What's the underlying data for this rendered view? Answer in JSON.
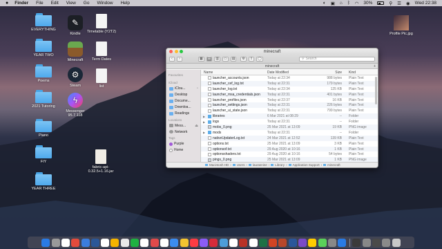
{
  "menubar": {
    "apple": "",
    "items": [
      "Finder",
      "File",
      "Edit",
      "View",
      "Go",
      "Window",
      "Help"
    ],
    "battery": "30%",
    "clock": "Wed 22:38"
  },
  "desktop_left": [
    {
      "label": "EVERYTHING",
      "type": "folder"
    },
    {
      "label": "YEAR TWO",
      "type": "folder"
    },
    {
      "label": "Poems",
      "type": "folder"
    },
    {
      "label": "2021 Tutoring",
      "type": "folder"
    },
    {
      "label": "Piano",
      "type": "folder"
    },
    {
      "label": "FIY",
      "type": "folder"
    },
    {
      "label": "YEAR THREE",
      "type": "folder"
    }
  ],
  "desktop_apps": [
    {
      "label": "Kindle",
      "icon": "kindle-icon",
      "color": "#1c1f25"
    },
    {
      "label": "Minecraft",
      "icon": "minecraft-icon",
      "color": "#5a8f3a"
    },
    {
      "label": "Steam",
      "icon": "steam-icon",
      "color": "#1b2838"
    },
    {
      "label": "Messenger\n95.7.118",
      "icon": "messenger-icon",
      "color": "#8b5cf6"
    }
  ],
  "desktop_docs": [
    {
      "label": "Timetable (Y2T2)"
    },
    {
      "label": "Term Dates"
    },
    {
      "label": "list"
    }
  ],
  "desktop_jar": {
    "label": "fabric-api-0.32.5+1.16.jar"
  },
  "desktop_right": {
    "label": "Profile Pic.jpg"
  },
  "finder": {
    "title": "minecraft",
    "path_title": "minecraft",
    "search_placeholder": "Search",
    "columns": {
      "name": "Name",
      "date": "Date Modified",
      "size": "Size",
      "kind": "Kind"
    },
    "sidebar": {
      "favourites_header": "Favourites",
      "icloud_header": "iCloud",
      "locations_header": "Locations",
      "tags_header": "Tags",
      "icloud_items": [
        "iClou...",
        "Desktop",
        "Docume...",
        "Downloa...",
        "Readings"
      ],
      "location_items": [
        "Mess...",
        "Network"
      ],
      "tag_items": [
        {
          "label": "Purple",
          "color": "#a259d9"
        },
        {
          "label": "Home",
          "color": "#cfcfcf"
        }
      ]
    },
    "rows": [
      {
        "name": "launcher_accounts.json",
        "date": "Today at 22:34",
        "size": "988 bytes",
        "kind": "Plain Text",
        "type": "file",
        "disclosure": ""
      },
      {
        "name": "launcher_cef_log.txt",
        "date": "Today at 22:31",
        "size": "179 bytes",
        "kind": "Plain Text",
        "type": "file",
        "disclosure": ""
      },
      {
        "name": "launcher_log.txt",
        "date": "Today at 22:34",
        "size": "125 KB",
        "kind": "Plain Text",
        "type": "file",
        "disclosure": ""
      },
      {
        "name": "launcher_msa_credentials.json",
        "date": "Today at 22:31",
        "size": "401 bytes",
        "kind": "Plain Text",
        "type": "file",
        "disclosure": ""
      },
      {
        "name": "launcher_profiles.json",
        "date": "Today at 22:37",
        "size": "16 KB",
        "kind": "Plain Text",
        "type": "file",
        "disclosure": ""
      },
      {
        "name": "launcher_settings.json",
        "date": "Today at 22:31",
        "size": "226 bytes",
        "kind": "Plain Text",
        "type": "file",
        "disclosure": ""
      },
      {
        "name": "launcher_ui_state.json",
        "date": "Today at 22:31",
        "size": "799 bytes",
        "kind": "Plain Text",
        "type": "file",
        "disclosure": ""
      },
      {
        "name": "libraries",
        "date": "6 Mar 2021 at 08:29",
        "size": "--",
        "kind": "Folder",
        "type": "folder",
        "disclosure": "▶"
      },
      {
        "name": "logs",
        "date": "Today at 22:31",
        "size": "--",
        "kind": "Folder",
        "type": "folder",
        "disclosure": "▶"
      },
      {
        "name": "mobs_0.png",
        "date": "25 Mar 2021 at 13:09",
        "size": "19 KB",
        "kind": "PNG image",
        "type": "image",
        "disclosure": ""
      },
      {
        "name": "mods",
        "date": "Today at 22:31",
        "size": "--",
        "kind": "Folder",
        "type": "folder",
        "disclosure": "▶"
      },
      {
        "name": "nativeUpdaterLog.txt",
        "date": "24 Mar 2021 at 12:52",
        "size": "139 KB",
        "kind": "Plain Text",
        "type": "file",
        "disclosure": ""
      },
      {
        "name": "options.txt",
        "date": "25 Mar 2021 at 13:09",
        "size": "3 KB",
        "kind": "Plain Text",
        "type": "file",
        "disclosure": ""
      },
      {
        "name": "optionsof.txt",
        "date": "29 Aug 2020 at 10:16",
        "size": "1 KB",
        "kind": "Plain Text",
        "type": "file",
        "disclosure": ""
      },
      {
        "name": "optionsshaders.txt",
        "date": "29 Aug 2020 at 10:16",
        "size": "54 bytes",
        "kind": "Plain Text",
        "type": "file",
        "disclosure": ""
      },
      {
        "name": "pings_0.png",
        "date": "25 Mar 2021 at 13:09",
        "size": "1 KB",
        "kind": "PNG image",
        "type": "image",
        "disclosure": ""
      }
    ],
    "pathbar": [
      "Macintosh HD",
      "Users",
      "laurasnine",
      "Library",
      "Application Support",
      "minecraft"
    ]
  },
  "dock": {
    "colors": [
      "#2a7be4",
      "#9a9a9a",
      "#ffffff",
      "#e34b3c",
      "#3b7ddd",
      "#2b5797",
      "#ffffff",
      "#f5b400",
      "#e8e8e8",
      "#1fb141",
      "#ffffff",
      "#e04a4a",
      "#ffffff",
      "#3c8df0",
      "#f4c430",
      "#fc3c44",
      "#8b5cf6",
      "#d62b3a",
      "#4e9dd9",
      "#ffffff",
      "#b83227",
      "#ffffff",
      "#1e7145",
      "#d04423",
      "#b7472a",
      "#2b579a",
      "#7a4bc9",
      "#ffcc00",
      "#5ad15a",
      "#888888",
      "#2a7be4",
      "#3a3a3a",
      "#888888",
      "#4a4a4a",
      "#8a8a8a",
      "#c8c8c8"
    ]
  }
}
